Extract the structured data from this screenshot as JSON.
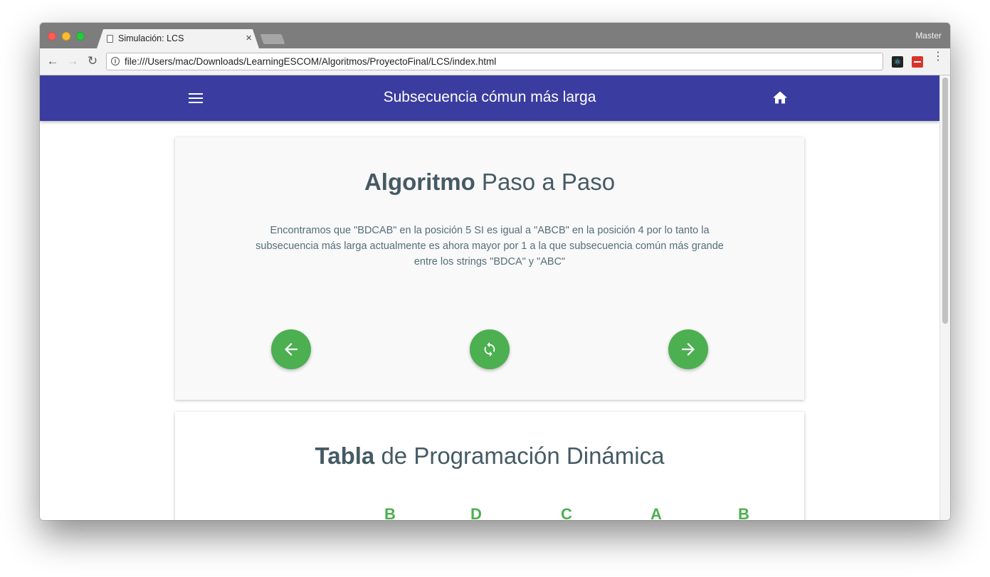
{
  "browser": {
    "tab_title": "Simulación: LCS",
    "tab_close": "×",
    "profile_name": "Master",
    "url": "file:///Users/mac/Downloads/LearningESCOM/Algoritmos/ProyectoFinal/LCS/index.html",
    "back_icon": "←",
    "forward_icon": "→",
    "reload_icon": "↻",
    "info_icon": "i",
    "extensions": [
      "react-devtools-icon",
      "lastpass-icon"
    ],
    "menu_icon": "⋮"
  },
  "appbar": {
    "title": "Subsecuencia cómun más larga",
    "color": "#3a3d9f",
    "menu_icon": "menu-icon",
    "home_icon": "home-icon"
  },
  "step_card": {
    "title_bold": "Algoritmo",
    "title_rest": " Paso a Paso",
    "description": "Encontramos que \"BDCAB\" en la posición 5 SI es igual a \"ABCB\" en la posición 4 por lo tanto la subsecuencia más larga actualmente es ahora mayor por 1 a la que subsecuencia común más grande entre los strings \"BDCA\" y \"ABC\"",
    "buttons": [
      "arrow-left-icon",
      "sync-icon",
      "arrow-right-icon"
    ],
    "button_color": "#4caf50"
  },
  "table_card": {
    "title_bold": "Tabla",
    "title_rest": " de Programación Dinámica",
    "column_headers": [
      "B",
      "D",
      "C",
      "A",
      "B"
    ]
  }
}
